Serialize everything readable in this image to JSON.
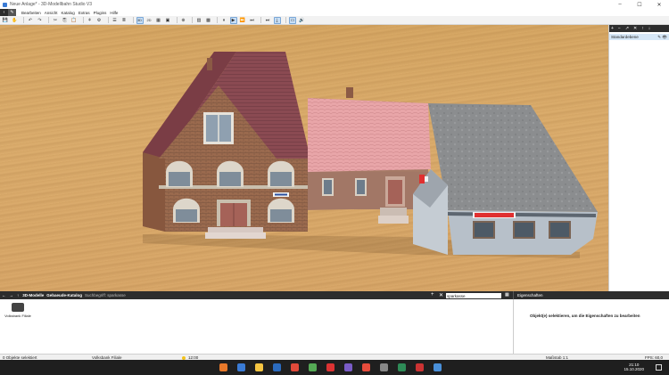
{
  "window": {
    "title": "Neue Anlage* - 3D-Modellbahn Studio V3",
    "controls": [
      "–",
      "☐",
      "✕"
    ]
  },
  "menu": {
    "items": [
      "Bearbeiten",
      "Ansicht",
      "Katalog",
      "Extras",
      "Plugins",
      "Hilfe"
    ]
  },
  "toolbar": {
    "buttons": [
      "save",
      "hand",
      "undo",
      "redo",
      "cut",
      "copy",
      "paste",
      "distribute",
      "align",
      "grid",
      "list",
      "3d",
      "2d",
      "tile",
      "tile2",
      "add",
      "stop-green",
      "stop-blue",
      "pause",
      "play",
      "fast",
      "faster",
      "end",
      "camera",
      "view",
      "volume"
    ],
    "icons": [
      "💾",
      "✋",
      "↶",
      "↷",
      "✂",
      "⎘",
      "📋",
      "⚘",
      "⚙",
      "☰",
      "≣",
      "3D",
      "2D",
      "▦",
      "▣",
      "⊕",
      "▨",
      "▩",
      "⏸",
      "▶",
      "⏩",
      "⏭",
      "⏭",
      "⤓",
      "▭",
      "🔊"
    ],
    "active": [
      "3d",
      "play",
      "camera",
      "view"
    ]
  },
  "layers": {
    "toolbar_icons": [
      "+",
      "−",
      "↗",
      "✕",
      "↑",
      "↓"
    ],
    "items": [
      {
        "name": "Standardebene",
        "icons": "✎ 👁"
      }
    ]
  },
  "catalog": {
    "nav_icons": [
      "←",
      "→",
      "↑"
    ],
    "breadcrumb": [
      "3D-Modelle",
      "Gebaeude-Katalog",
      "Suchbegriff: sparkasse"
    ],
    "search": {
      "value": "sparkasse"
    },
    "items": [
      {
        "label": "Volksbank Filiale"
      }
    ],
    "add_icon": "+",
    "close_icon": "✕",
    "grid_icon": "▦"
  },
  "properties": {
    "title": "Eigenschaften",
    "message": "Objekt(e) selektieren, um die Eigenschaften zu bearbeiten"
  },
  "status": {
    "selection": "0 Objekte selektiert",
    "object": "Volksbank Filiale",
    "time": "12:00",
    "scale": "Maßstab 1:1",
    "fps": "FPS: 60,0"
  },
  "taskbar": {
    "clock_time": "21:10",
    "clock_date": "15.10.2020",
    "colors": [
      "#e8792a",
      "#3a7bd5",
      "#f5c542",
      "#2b6bbf",
      "#e04a3a",
      "#55aa55",
      "#d33",
      "#7a5cc7",
      "#e74c3c",
      "#888",
      "#2e8b57",
      "#cc3333",
      "#4a90d9"
    ]
  }
}
